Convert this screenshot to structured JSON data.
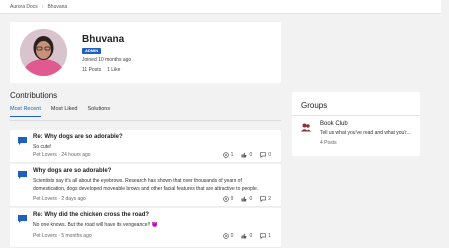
{
  "breadcrumb": {
    "root": "Aurora Docs",
    "current": "Bhuvana"
  },
  "profile": {
    "name": "Bhuvana",
    "badge": "ADMIN",
    "joined": "Joined 10 months ago",
    "posts": "11 Posts",
    "likes": "1 Like"
  },
  "contributions": {
    "title": "Contributions",
    "tabs": [
      "Most Recent",
      "Most Liked",
      "Solutions"
    ],
    "posts": [
      {
        "title": "Re: Why dogs are so adorable?",
        "body": "So cute!",
        "meta": "Pet Lovers · 24 hours ago",
        "views": "1",
        "likes": "0",
        "replies": "0"
      },
      {
        "title": "Why dogs are so adorable?",
        "body": "Scientists say it's all about the eyebrows. Research has shown that over thousands of years of domestication, dogs developed moveable brows and other facial features that are attractive to people.",
        "meta": "Pet Lovers · 2 days ago",
        "views": "9",
        "likes": "0",
        "replies": "2"
      },
      {
        "title": "Re: Why did the chicken cross the road?",
        "body": "No one knows. But the road will have its vengeance!! 😈",
        "meta": "Pet Lovers · 5 months ago",
        "views": "0",
        "likes": "0",
        "replies": "1"
      }
    ]
  },
  "groups": {
    "title": "Groups",
    "items": [
      {
        "name": "Book Club",
        "description": "Tell us what you've read and what you'r...",
        "posts": "4 Posts"
      }
    ]
  },
  "colors": {
    "accent": "#1f5fbf",
    "background": "#f2f2f2",
    "card": "#ffffff"
  }
}
